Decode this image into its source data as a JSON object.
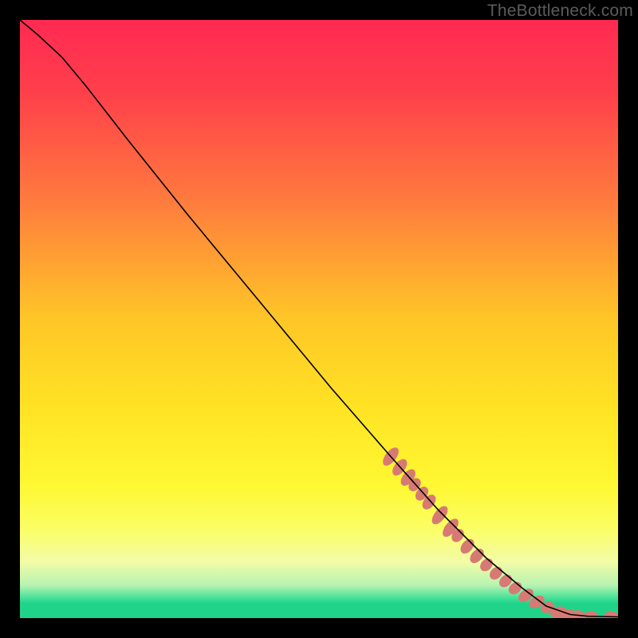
{
  "watermark": "TheBottleneck.com",
  "chart_data": {
    "type": "line",
    "title": "",
    "xlabel": "",
    "ylabel": "",
    "xlim": [
      0,
      100
    ],
    "ylim": [
      0,
      100
    ],
    "gradient_stops": [
      {
        "offset": 0.0,
        "color": "#ff2a52"
      },
      {
        "offset": 0.12,
        "color": "#ff3f4b"
      },
      {
        "offset": 0.3,
        "color": "#ff7a3e"
      },
      {
        "offset": 0.5,
        "color": "#ffc627"
      },
      {
        "offset": 0.65,
        "color": "#ffe324"
      },
      {
        "offset": 0.78,
        "color": "#fff833"
      },
      {
        "offset": 0.85,
        "color": "#fbfe64"
      },
      {
        "offset": 0.905,
        "color": "#f3fca6"
      },
      {
        "offset": 0.945,
        "color": "#b7f3b1"
      },
      {
        "offset": 0.965,
        "color": "#4de29a"
      },
      {
        "offset": 0.975,
        "color": "#1fd489"
      },
      {
        "offset": 1.0,
        "color": "#1fd489"
      }
    ],
    "curve": [
      {
        "x": 0.0,
        "y": 100.0
      },
      {
        "x": 3.0,
        "y": 97.5
      },
      {
        "x": 7.0,
        "y": 93.8
      },
      {
        "x": 11.0,
        "y": 89.0
      },
      {
        "x": 18.0,
        "y": 80.0
      },
      {
        "x": 28.0,
        "y": 67.5
      },
      {
        "x": 40.0,
        "y": 53.0
      },
      {
        "x": 52.0,
        "y": 38.5
      },
      {
        "x": 62.0,
        "y": 27.0
      },
      {
        "x": 70.0,
        "y": 18.0
      },
      {
        "x": 78.0,
        "y": 10.0
      },
      {
        "x": 84.0,
        "y": 5.0
      },
      {
        "x": 88.0,
        "y": 2.0
      },
      {
        "x": 92.0,
        "y": 0.6
      },
      {
        "x": 95.0,
        "y": 0.3
      },
      {
        "x": 100.0,
        "y": 0.2
      }
    ],
    "flat_segment_y": 0.2,
    "scatter": [
      {
        "x": 62.0,
        "y": 27.0,
        "rwx": 1.8,
        "rhy": 0.9,
        "rot": -52
      },
      {
        "x": 63.5,
        "y": 25.2,
        "rwx": 1.6,
        "rhy": 0.9,
        "rot": -52
      },
      {
        "x": 64.9,
        "y": 23.5,
        "rwx": 1.6,
        "rhy": 0.9,
        "rot": -52
      },
      {
        "x": 66.0,
        "y": 22.3,
        "rwx": 1.2,
        "rhy": 0.9,
        "rot": -52
      },
      {
        "x": 67.2,
        "y": 20.8,
        "rwx": 1.3,
        "rhy": 0.9,
        "rot": -52
      },
      {
        "x": 68.4,
        "y": 19.4,
        "rwx": 1.4,
        "rhy": 0.9,
        "rot": -52
      },
      {
        "x": 70.2,
        "y": 17.2,
        "rwx": 1.8,
        "rhy": 0.9,
        "rot": -52
      },
      {
        "x": 72.0,
        "y": 15.1,
        "rwx": 1.8,
        "rhy": 0.9,
        "rot": -52
      },
      {
        "x": 73.2,
        "y": 13.8,
        "rwx": 1.2,
        "rhy": 0.9,
        "rot": -52
      },
      {
        "x": 74.8,
        "y": 12.0,
        "rwx": 1.4,
        "rhy": 0.9,
        "rot": -50
      },
      {
        "x": 76.4,
        "y": 10.4,
        "rwx": 1.4,
        "rhy": 0.9,
        "rot": -48
      },
      {
        "x": 78.0,
        "y": 8.9,
        "rwx": 1.2,
        "rhy": 0.9,
        "rot": -47
      },
      {
        "x": 79.6,
        "y": 7.5,
        "rwx": 1.2,
        "rhy": 0.9,
        "rot": -45
      },
      {
        "x": 81.2,
        "y": 6.2,
        "rwx": 1.2,
        "rhy": 0.9,
        "rot": -43
      },
      {
        "x": 82.8,
        "y": 5.0,
        "rwx": 1.2,
        "rhy": 0.9,
        "rot": -40
      },
      {
        "x": 84.6,
        "y": 3.8,
        "rwx": 1.4,
        "rhy": 0.9,
        "rot": -36
      },
      {
        "x": 86.4,
        "y": 2.7,
        "rwx": 1.4,
        "rhy": 0.9,
        "rot": -32
      },
      {
        "x": 88.2,
        "y": 1.8,
        "rwx": 1.2,
        "rhy": 0.9,
        "rot": -25
      },
      {
        "x": 90.0,
        "y": 1.0,
        "rwx": 1.4,
        "rhy": 0.9,
        "rot": -14
      },
      {
        "x": 91.6,
        "y": 0.6,
        "rwx": 1.2,
        "rhy": 0.9,
        "rot": -8
      },
      {
        "x": 93.2,
        "y": 0.4,
        "rwx": 1.2,
        "rhy": 0.9,
        "rot": -3
      },
      {
        "x": 95.5,
        "y": 0.3,
        "rwx": 1.2,
        "rhy": 0.9,
        "rot": 0
      },
      {
        "x": 98.8,
        "y": 0.25,
        "rwx": 1.2,
        "rhy": 0.9,
        "rot": 0
      }
    ],
    "scatter_color": "#d77a73",
    "curve_color": "#000000"
  }
}
